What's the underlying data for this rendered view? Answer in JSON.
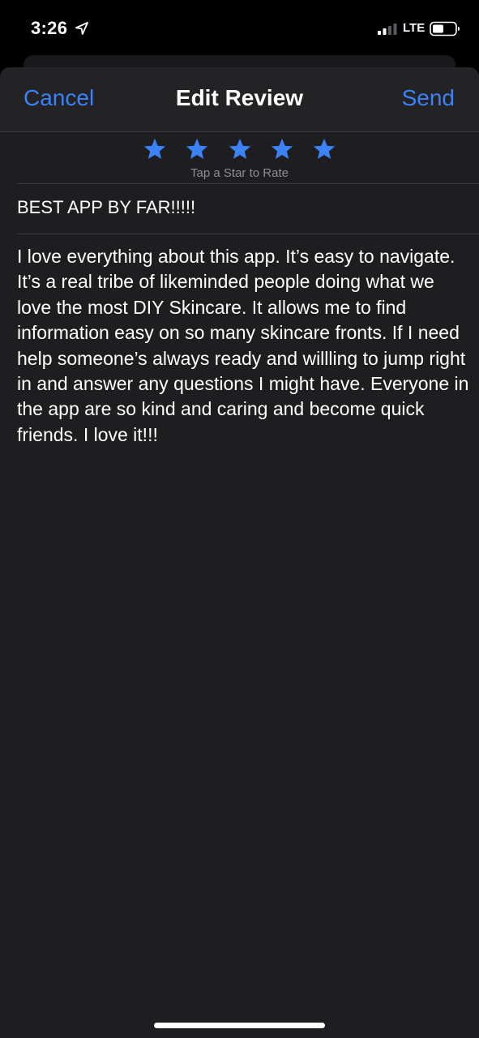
{
  "status_bar": {
    "time": "3:26",
    "network": "LTE",
    "icons": [
      "location-arrow-icon",
      "cellular-signal-icon",
      "battery-icon"
    ]
  },
  "nav": {
    "cancel_label": "Cancel",
    "title": "Edit Review",
    "send_label": "Send"
  },
  "rating": {
    "stars_filled": 5,
    "stars_total": 5,
    "hint": "Tap a Star to Rate",
    "star_icon": "star-icon"
  },
  "review": {
    "title": "BEST APP BY FAR!!!!!",
    "body": "I love everything about this app. It’s easy to navigate. It’s a real tribe of likeminded people doing what we love the most DIY Skincare. It allows me to find information easy on so many skincare fronts. If I need help someone’s always ready and willling to jump right in and answer any questions I might have. Everyone in the app are so kind and caring and become quick friends. I love it!!!"
  },
  "colors": {
    "accent": "#3b82f6",
    "sheet_background": "#1e1e20",
    "nav_background": "#232325",
    "secondary_text": "#8e8e93",
    "separator": "#3a3a3c"
  }
}
